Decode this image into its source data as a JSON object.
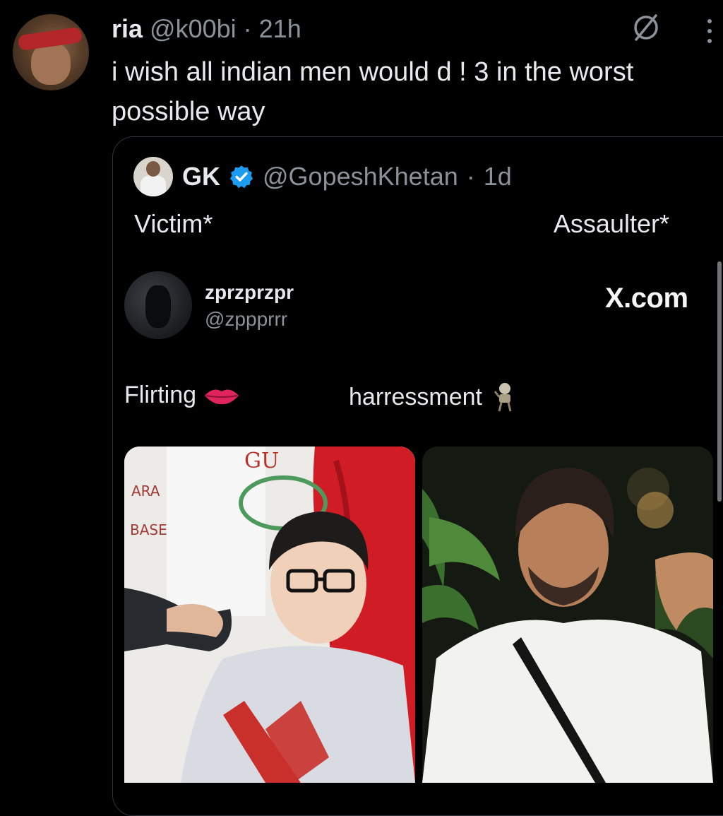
{
  "tweet": {
    "author_name": "ria",
    "author_handle": "@k00bi",
    "separator": "·",
    "time": "21h",
    "text": "i wish all indian men would d ! 3 in the worst possible way"
  },
  "quoted_tweet": {
    "author_name": "GK",
    "author_handle": "@GopeshKhetan",
    "separator": "·",
    "time": "1d",
    "label_left": "Victim*",
    "label_right": "Assaulter*",
    "embedded": {
      "name": "zprzprzpr",
      "handle": "@zppprrr",
      "brand": "X.com",
      "caption_left": "Flirting",
      "caption_right": "harressment"
    }
  },
  "icons": {
    "mute": "mute-icon",
    "more": "more-vertical-icon",
    "verified": "verified-badge-icon",
    "lips": "lips-emoji",
    "skeleton": "skeleton-emoji"
  },
  "colors": {
    "background": "#000000",
    "text": "#e7e9ea",
    "secondary": "#8b9299",
    "verified": "#1d9bf0"
  }
}
